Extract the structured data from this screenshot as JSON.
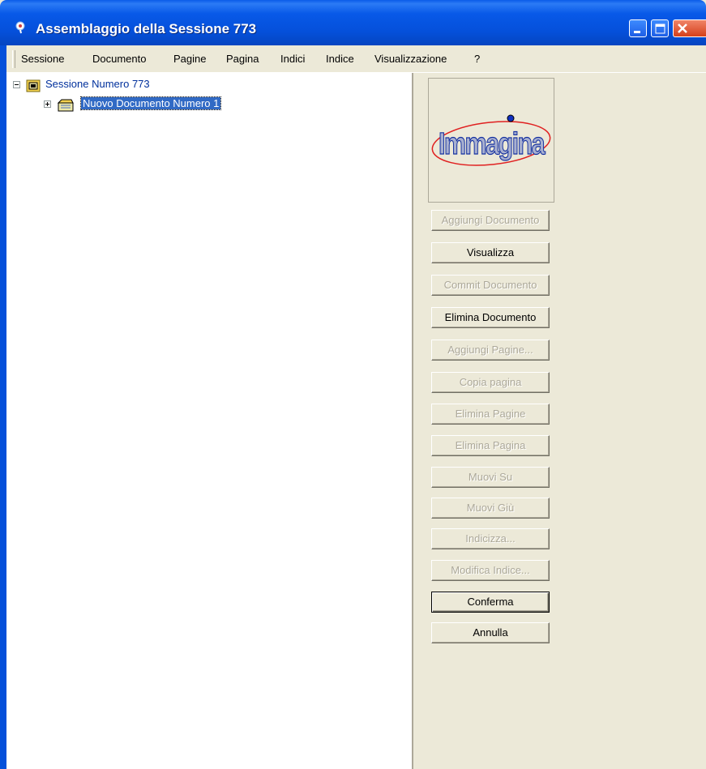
{
  "window": {
    "title": "Assemblaggio della Sessione 773",
    "controls": {
      "minimize": "minimize",
      "maximize": "maximize",
      "close": "close"
    }
  },
  "menu": {
    "items": [
      "Sessione",
      "Documento",
      "Pagine",
      "Pagina",
      "Indici",
      "Indice",
      "Visualizzazione",
      "?"
    ]
  },
  "tree": {
    "root": {
      "label": "Sessione Numero 773",
      "expander": "−",
      "icon": "session-icon"
    },
    "child": {
      "label": "Nuovo Documento Numero 1",
      "expander": "+",
      "icon": "document-folder-icon"
    }
  },
  "logo": {
    "text": "Immagina"
  },
  "buttons": [
    {
      "label": "Aggiungi Documento",
      "enabled": false
    },
    {
      "label": "Visualizza",
      "enabled": true
    },
    {
      "label": "Commit Documento",
      "enabled": false
    },
    {
      "label": "Elimina Documento",
      "enabled": true
    },
    {
      "label": "Aggiungi Pagine...",
      "enabled": false
    },
    {
      "label": "Copia pagina",
      "enabled": false
    },
    {
      "label": "Elimina Pagine",
      "enabled": false
    },
    {
      "label": "Elimina Pagina",
      "enabled": false
    },
    {
      "label": "Muovi Su",
      "enabled": false
    },
    {
      "label": "Muovi Giù",
      "enabled": false
    },
    {
      "label": "Indicizza...",
      "enabled": false
    },
    {
      "label": "Modifica Indice...",
      "enabled": false
    },
    {
      "label": "Conferma",
      "enabled": true
    },
    {
      "label": "Annulla",
      "enabled": true
    }
  ],
  "colors": {
    "titlebar": "#0550DA",
    "selection": "#316AC5",
    "panel": "#ECE9D8",
    "disabled_text": "#ACA899"
  }
}
